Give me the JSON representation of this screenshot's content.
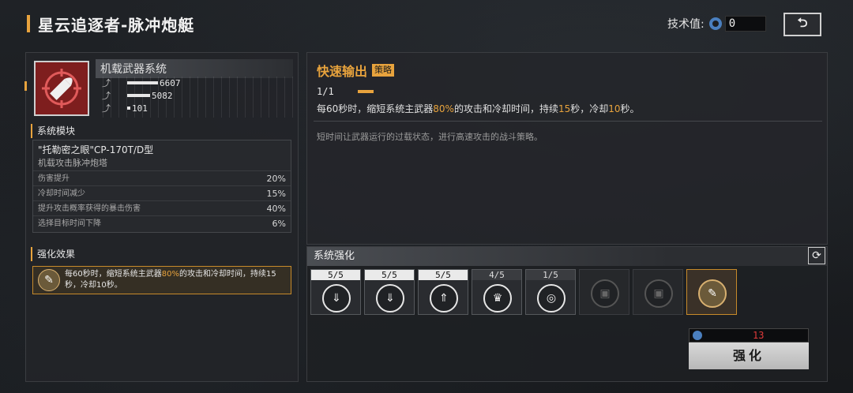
{
  "header": {
    "title": "星云追逐者-脉冲炮艇",
    "tech_label": "技术值:",
    "tech_value": "0",
    "back_icon": "back-arrow-icon"
  },
  "weapon": {
    "name": "机载武器系统",
    "icon": "bullet-crosshair-icon",
    "stats": [
      {
        "icon": "damage-icon",
        "value": "6607",
        "fill": 0.55
      },
      {
        "icon": "fire-rate-icon",
        "value": "5082",
        "fill": 0.42
      },
      {
        "icon": "range-icon",
        "value": "101",
        "fill": 0.06
      }
    ]
  },
  "module": {
    "section": "系统模块",
    "title": "\"托勒密之眼\"CP-170T/D型",
    "subtitle": "机载攻击脉冲炮塔",
    "rows": [
      {
        "label": "伤害提升",
        "value": "20%"
      },
      {
        "label": "冷却时间减少",
        "value": "15%"
      },
      {
        "label": "提升攻击概率获得的暴击伤害",
        "value": "40%"
      },
      {
        "label": "选择目标时间下降",
        "value": "6%"
      }
    ]
  },
  "enhance_effect": {
    "section": "强化效果",
    "text_a": "每60秒时，缩短系统主武器",
    "hl": "80%",
    "text_b": "的攻击和冷却时间，持续15秒，冷却10秒。"
  },
  "skill": {
    "name": "快速输出",
    "tag": "策略",
    "level": "1/1",
    "desc_a": "每60秒时，缩短系统主武器",
    "desc_hl1": "80%",
    "desc_b": "的攻击和冷却时间，持续",
    "desc_hl2": "15",
    "desc_c": "秒，冷却",
    "desc_hl3": "10",
    "desc_d": "秒。",
    "flavor": "短时间让武器运行的过载状态，进行高速攻击的战斗策略。"
  },
  "system": {
    "title": "系统强化",
    "slots": [
      {
        "count": "5/5",
        "icon": "shield-arrow-icon",
        "glyph": "⇓"
      },
      {
        "count": "5/5",
        "icon": "shield-arrow-icon",
        "glyph": "⇓"
      },
      {
        "count": "5/5",
        "icon": "triple-arrow-icon",
        "glyph": "⇑"
      },
      {
        "count": "4/5",
        "icon": "crown-icon",
        "glyph": "♛"
      },
      {
        "count": "1/5",
        "icon": "target-icon",
        "glyph": "◎"
      },
      {
        "count": "",
        "icon": "chip-locked-icon",
        "glyph": "▣"
      },
      {
        "count": "",
        "icon": "chip-locked-icon",
        "glyph": "▣"
      },
      {
        "count": "",
        "icon": "quick-output-icon",
        "glyph": "✎"
      }
    ],
    "cost": "13",
    "button": "强化"
  }
}
